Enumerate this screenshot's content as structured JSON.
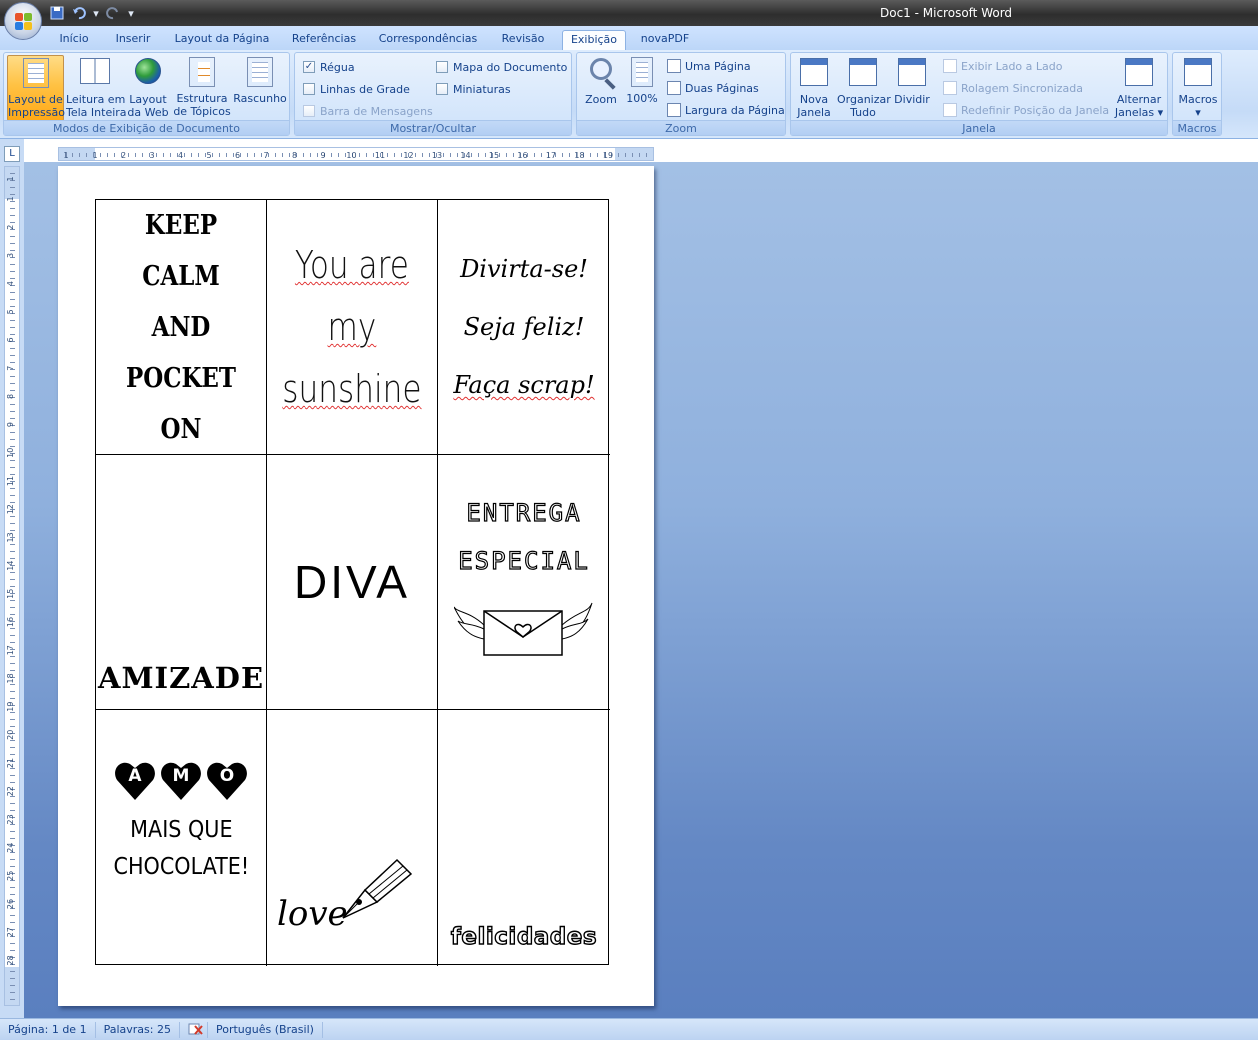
{
  "window": {
    "title": "Doc1 - Microsoft Word"
  },
  "quick_access": {
    "save_icon": "save-icon",
    "undo_icon": "undo-icon",
    "redo_icon": "redo-icon",
    "customize_icon": "chevron-down-icon"
  },
  "tabs": [
    {
      "label": "Início",
      "active": false
    },
    {
      "label": "Inserir",
      "active": false
    },
    {
      "label": "Layout da Página",
      "active": false
    },
    {
      "label": "Referências",
      "active": false
    },
    {
      "label": "Correspondências",
      "active": false
    },
    {
      "label": "Revisão",
      "active": false
    },
    {
      "label": "Exibição",
      "active": true
    },
    {
      "label": "novaPDF",
      "active": false
    }
  ],
  "ribbon": {
    "views": {
      "label": "Modos de Exibição de Documento",
      "buttons": [
        {
          "line1": "Layout de",
          "line2": "Impressão",
          "active": true
        },
        {
          "line1": "Leitura em",
          "line2": "Tela Inteira",
          "active": false
        },
        {
          "line1": "Layout",
          "line2": "da Web",
          "active": false
        },
        {
          "line1": "Estrutura",
          "line2": "de Tópicos",
          "active": false
        },
        {
          "line1": "Rascunho",
          "line2": "",
          "active": false
        }
      ]
    },
    "show_hide": {
      "label": "Mostrar/Ocultar",
      "checks": [
        {
          "label": "Régua",
          "checked": true,
          "enabled": true
        },
        {
          "label": "Linhas de Grade",
          "checked": false,
          "enabled": true
        },
        {
          "label": "Barra de Mensagens",
          "checked": false,
          "enabled": false
        },
        {
          "label": "Mapa do Documento",
          "checked": false,
          "enabled": true
        },
        {
          "label": "Miniaturas",
          "checked": false,
          "enabled": true
        }
      ]
    },
    "zoom": {
      "label": "Zoom",
      "zoom_button": "Zoom",
      "percent_button": "100%",
      "small": [
        "Uma Página",
        "Duas Páginas",
        "Largura da Página"
      ]
    },
    "window_group": {
      "label": "Janela",
      "new_window": {
        "line1": "Nova",
        "line2": "Janela"
      },
      "arrange": {
        "line1": "Organizar",
        "line2": "Tudo"
      },
      "split": {
        "line1": "Dividir",
        "line2": ""
      },
      "small": [
        "Exibir Lado a Lado",
        "Rolagem Sincronizada",
        "Redefinir Posição da Janela"
      ],
      "switch": {
        "line1": "Alternar",
        "line2": "Janelas ▾"
      }
    },
    "macros": {
      "label": "Macros",
      "button": "Macros"
    }
  },
  "ruler": {
    "corner": "L",
    "h_numbers": [
      "1",
      "1",
      "2",
      "3",
      "4",
      "5",
      "6",
      "7",
      "8",
      "9",
      "10",
      "11",
      "12",
      "13",
      "14",
      "15",
      "16",
      "17",
      "18",
      "19"
    ],
    "v_numbers": [
      "1",
      "1",
      "2",
      "3",
      "4",
      "5",
      "6",
      "7",
      "8",
      "9",
      "10",
      "11",
      "12",
      "13",
      "14",
      "15",
      "16",
      "17",
      "18",
      "19",
      "20",
      "21",
      "22",
      "23",
      "24",
      "25",
      "26",
      "27",
      "28"
    ]
  },
  "document": {
    "cells": {
      "c1": [
        "KEEP",
        "CALM",
        "AND",
        "POCKET ON"
      ],
      "c2": [
        "You are",
        "my",
        "sunshine"
      ],
      "c3": [
        "Divirta-se!",
        "Seja feliz!",
        "Faça scrap!"
      ],
      "c4": "AMIZADE",
      "c5": "DIVA",
      "c6": [
        "ENTREGA",
        "ESPECIAL"
      ],
      "c7": {
        "hearts": [
          "A",
          "M",
          "O"
        ],
        "lines": [
          "MAIS QUE",
          "CHOCOLATE!"
        ]
      },
      "c8": "love",
      "c9": "felicidades"
    }
  },
  "status": {
    "page": "Página: 1 de 1",
    "words": "Palavras: 25",
    "proofing_icon": "spellcheck-icon",
    "language": "Português (Brasil)"
  }
}
